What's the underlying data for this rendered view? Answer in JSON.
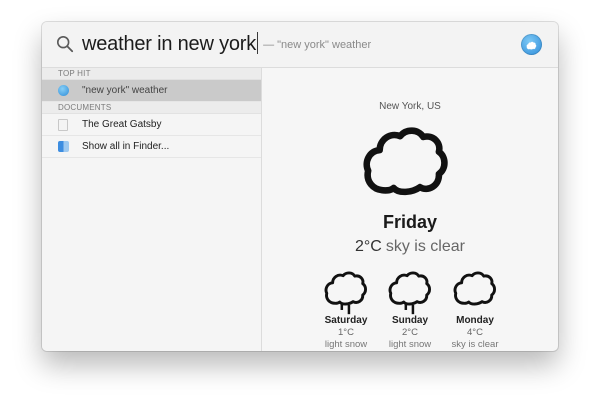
{
  "search": {
    "query": "weather in new york",
    "suggestion": "— \"new york\" weather",
    "icon": "magnifier-icon"
  },
  "sections": {
    "top_hit": "TOP HIT",
    "documents": "DOCUMENTS"
  },
  "results": {
    "top_hit_label": "\"new york\" weather",
    "document_label": "The Great Gatsby",
    "finder_label": "Show all in Finder..."
  },
  "weather": {
    "location": "New York, US",
    "day": "Friday",
    "temp": "2°C",
    "condition": "sky is clear",
    "forecast": [
      {
        "day": "Saturday",
        "temp": "1°C",
        "condition": "light snow",
        "icon": "snow-cloud-icon"
      },
      {
        "day": "Sunday",
        "temp": "2°C",
        "condition": "light snow",
        "icon": "snow-cloud-icon"
      },
      {
        "day": "Monday",
        "temp": "4°C",
        "condition": "sky is clear",
        "icon": "cloud-icon"
      }
    ]
  },
  "colors": {
    "selected_row": "#cacaca",
    "panel_bg": "#f6f6f6",
    "text": "#1c1c1c"
  }
}
